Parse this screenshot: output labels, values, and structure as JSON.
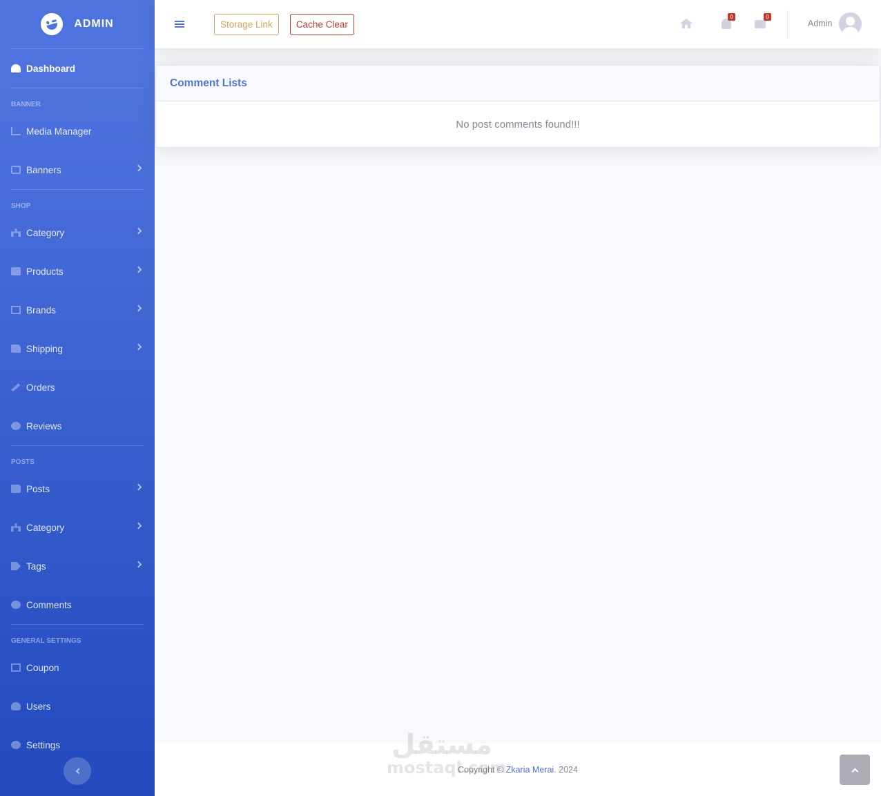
{
  "brand": {
    "name": "ADMIN",
    "icon": "laugh-wink-icon"
  },
  "sidebar": {
    "dashboard": "Dashboard",
    "sections": [
      {
        "heading": "BANNER",
        "items": [
          {
            "label": "Media Manager",
            "icon": "chart-area-icon",
            "expandable": false
          },
          {
            "label": "Banners",
            "icon": "image-icon",
            "expandable": true
          }
        ]
      },
      {
        "heading": "SHOP",
        "items": [
          {
            "label": "Category",
            "icon": "sitemap-icon",
            "expandable": true
          },
          {
            "label": "Products",
            "icon": "cubes-icon",
            "expandable": true
          },
          {
            "label": "Brands",
            "icon": "table-icon",
            "expandable": true
          },
          {
            "label": "Shipping",
            "icon": "truck-icon",
            "expandable": true
          },
          {
            "label": "Orders",
            "icon": "hammer-icon",
            "expandable": false
          },
          {
            "label": "Reviews",
            "icon": "comments-icon",
            "expandable": false
          }
        ]
      },
      {
        "heading": "POSTS",
        "items": [
          {
            "label": "Posts",
            "icon": "folder-icon",
            "expandable": true
          },
          {
            "label": "Category",
            "icon": "sitemap-icon",
            "expandable": true
          },
          {
            "label": "Tags",
            "icon": "tags-icon",
            "expandable": true
          },
          {
            "label": "Comments",
            "icon": "comments-icon",
            "expandable": false
          }
        ]
      },
      {
        "heading": "GENERAL SETTINGS",
        "items": [
          {
            "label": "Coupon",
            "icon": "table-icon",
            "expandable": false
          },
          {
            "label": "Users",
            "icon": "users-icon",
            "expandable": false
          },
          {
            "label": "Settings",
            "icon": "cog-icon",
            "expandable": false
          }
        ]
      }
    ]
  },
  "topbar": {
    "storage_link": "Storage Link",
    "cache_clear": "Cache Clear",
    "alerts_count": "0",
    "messages_count": "0",
    "user_name": "Admin"
  },
  "card": {
    "title": "Comment Lists",
    "empty_message": "No post comments found!!!"
  },
  "footer": {
    "copyright_prefix": "Copyright ©",
    "author": "Zkaria Merai",
    "year_suffix": ". 2024",
    "watermark_arabic": "مستقل",
    "watermark_latin": "mostaql.com"
  },
  "colors": {
    "primary": "#4e73df",
    "warning": "#d4a258",
    "danger": "#c0392b"
  }
}
